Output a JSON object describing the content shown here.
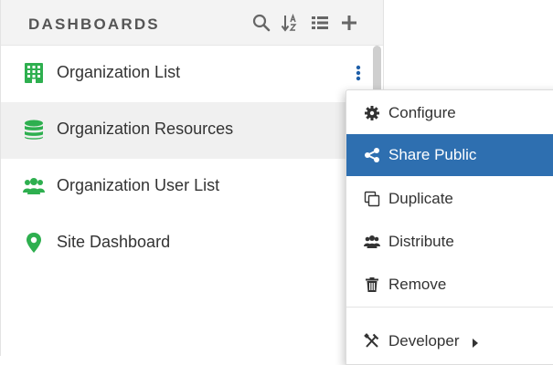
{
  "panel": {
    "title": "DASHBOARDS",
    "header_icons": [
      "search-icon",
      "sort-az-icon",
      "list-icon",
      "plus-icon"
    ]
  },
  "dashboards": [
    {
      "label": "Organization List",
      "icon": "building-icon",
      "color": "#2eaf4f"
    },
    {
      "label": "Organization Resources",
      "icon": "database-icon",
      "color": "#2eaf4f"
    },
    {
      "label": "Organization User List",
      "icon": "users-icon",
      "color": "#2eaf4f"
    },
    {
      "label": "Site Dashboard",
      "icon": "map-marker-icon",
      "color": "#2eaf4f"
    }
  ],
  "context_menu": {
    "items": [
      {
        "label": "Configure",
        "icon": "gear-icon"
      },
      {
        "label": "Share Public",
        "icon": "share-icon",
        "active": true
      },
      {
        "label": "Duplicate",
        "icon": "copy-icon"
      },
      {
        "label": "Distribute",
        "icon": "users-icon"
      },
      {
        "label": "Remove",
        "icon": "trash-icon"
      },
      {
        "label": "Developer",
        "icon": "tools-icon",
        "has_submenu": true
      }
    ]
  },
  "colors": {
    "accent_green": "#2eaf4f",
    "kebab_blue": "#1f5fa8",
    "active_blue": "#2e6fb0"
  }
}
